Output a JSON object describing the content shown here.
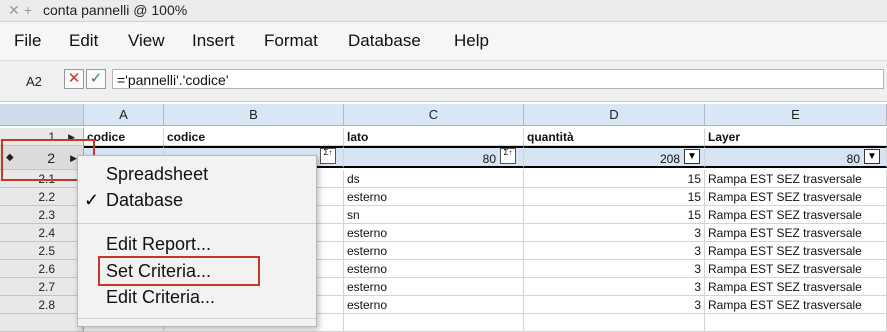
{
  "window": {
    "title": "conta pannelli @ 100%",
    "close_glyph": "✕",
    "add_glyph": "+"
  },
  "menubar": {
    "items": [
      "File",
      "Edit",
      "View",
      "Insert",
      "Format",
      "Database",
      "Help"
    ]
  },
  "formula_bar": {
    "cell_ref": "A2",
    "cancel_glyph": "✕",
    "accept_glyph": "✓",
    "formula": "='pannelli'.'codice'"
  },
  "grid": {
    "columns": [
      "A",
      "B",
      "C",
      "D",
      "E"
    ],
    "header_row": {
      "row": "1",
      "a": "codice",
      "b": "codice",
      "c": "lato",
      "d": "quantità",
      "e": "Layer"
    },
    "criteria_row": {
      "row": "2",
      "b": "",
      "c": "80",
      "d": "208",
      "e": "80",
      "sort_glyph": "Σ↑"
    },
    "rows": [
      {
        "row": "2.1",
        "c": "ds",
        "d": "15",
        "e": "Rampa EST SEZ trasversale"
      },
      {
        "row": "2.2",
        "c": "esterno",
        "d": "15",
        "e": "Rampa EST SEZ trasversale"
      },
      {
        "row": "2.3",
        "c": "sn",
        "d": "15",
        "e": "Rampa EST SEZ trasversale"
      },
      {
        "row": "2.4",
        "c": "esterno",
        "d": "3",
        "e": "Rampa EST SEZ trasversale"
      },
      {
        "row": "2.5",
        "c": "esterno",
        "d": "3",
        "e": "Rampa EST SEZ trasversale"
      },
      {
        "row": "2.6",
        "c": "esterno",
        "d": "3",
        "e": "Rampa EST SEZ trasversale"
      },
      {
        "row": "2.7",
        "c": "esterno",
        "d": "3",
        "e": "Rampa EST SEZ trasversale"
      },
      {
        "row": "2.8",
        "c": "esterno",
        "d": "3",
        "e": "Rampa EST SEZ trasversale"
      }
    ]
  },
  "context_menu": {
    "items": {
      "spreadsheet": "Spreadsheet",
      "database": "Database",
      "edit_report": "Edit Report...",
      "set_criteria": "Set Criteria...",
      "edit_criteria": "Edit Criteria..."
    },
    "checked": "Database",
    "check_glyph": "✓"
  },
  "colors": {
    "highlight_box": "#c0392b",
    "column_header": "#d8e6f5",
    "criteria_row": "#d6e4f4"
  }
}
